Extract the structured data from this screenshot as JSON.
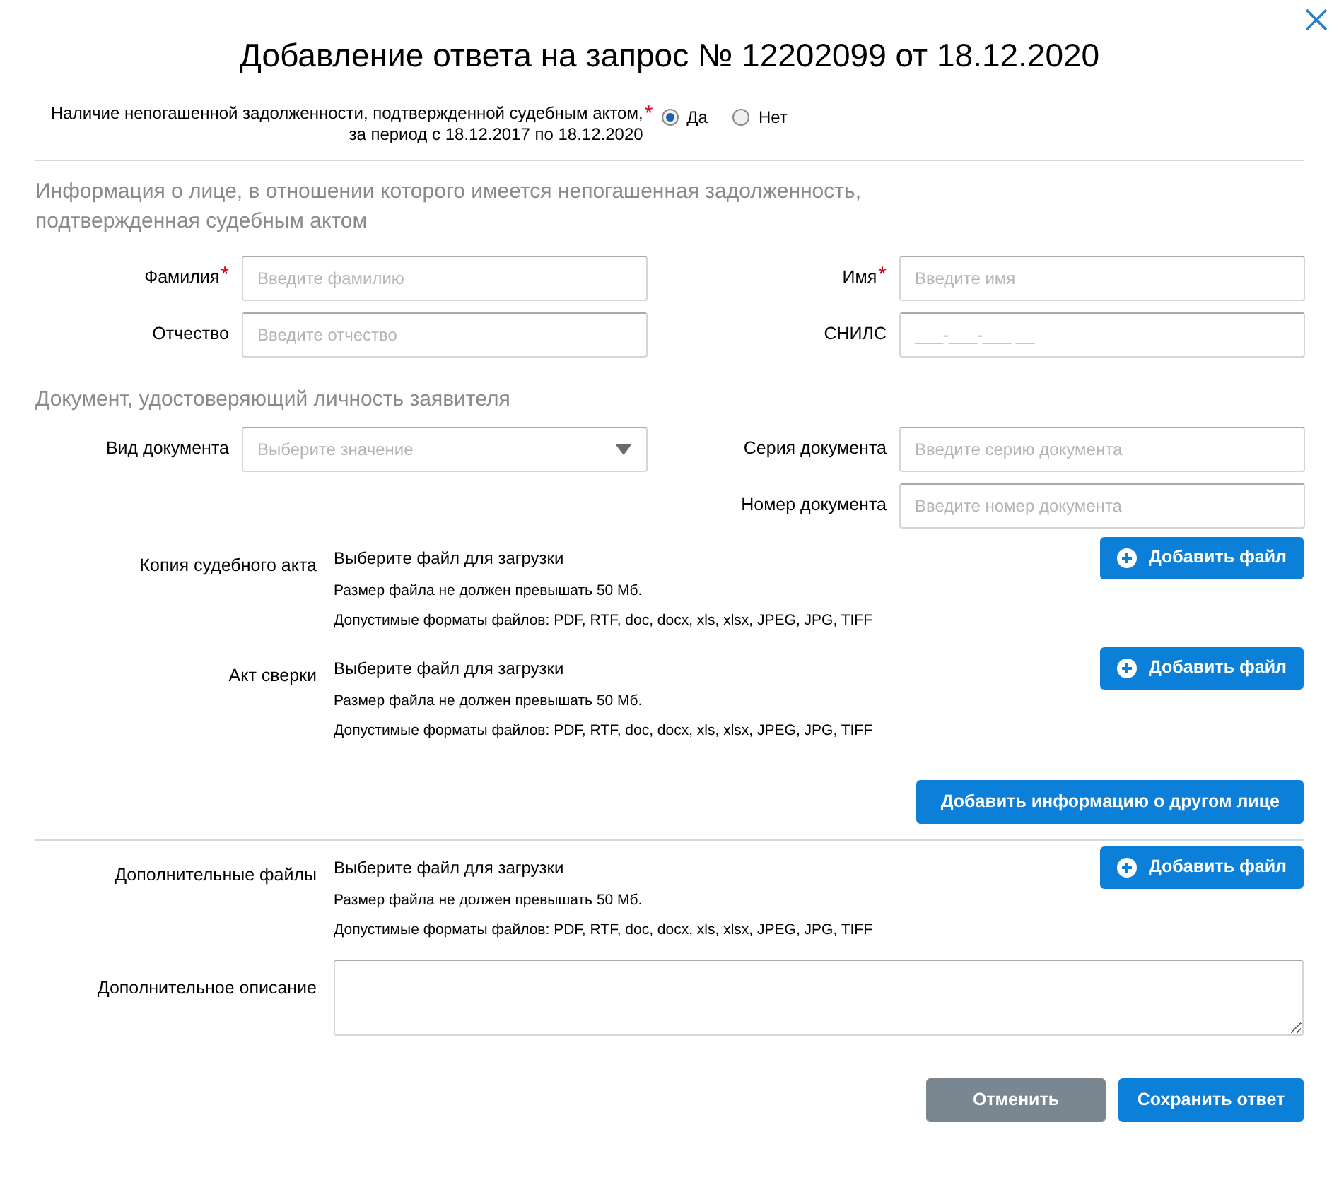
{
  "title": "Добавление ответа на запрос № 12202099 от 18.12.2020",
  "debt_question": {
    "line1": "Наличие непогашенной задолженности, подтвержденной судебным актом,",
    "line2": "за период с 18.12.2017 по 18.12.2020",
    "required_mark": "*",
    "options": [
      {
        "label": "Да",
        "selected": true
      },
      {
        "label": "Нет",
        "selected": false
      }
    ]
  },
  "person_section": {
    "heading": "Информация о лице, в отношении которого имеется непогашенная задолженность, подтвержденная судебным актом",
    "left": [
      {
        "label": "Фамилия",
        "required_mark": "*",
        "kind": "text",
        "placeholder": "Введите фамилию"
      },
      {
        "label": "Отчество",
        "kind": "text",
        "placeholder": "Введите отчество"
      }
    ],
    "right": [
      {
        "label": "Имя",
        "required_mark": "*",
        "kind": "text",
        "placeholder": "Введите имя"
      },
      {
        "label": "СНИЛС",
        "kind": "text",
        "placeholder": "___-___-___ __"
      }
    ]
  },
  "document_section": {
    "heading": "Документ, удостоверяющий личность заявителя",
    "left": [
      {
        "label": "Вид документа",
        "kind": "select",
        "placeholder": "Выберите значение"
      }
    ],
    "right": [
      {
        "label": "Серия документа",
        "kind": "text",
        "placeholder": "Введите серию документа"
      },
      {
        "label": "Номер документа",
        "kind": "text",
        "placeholder": "Введите номер документа"
      }
    ]
  },
  "files": [
    {
      "label": "Копия судебного акта",
      "prompt": "Выберите файл для загрузки",
      "size_note": "Размер файла не должен превышать 50 Мб.",
      "formats_note": "Допустимые форматы файлов: PDF, RTF, doc, docx, xls, xlsx, JPEG, JPG, TIFF",
      "button": "Добавить файл"
    },
    {
      "label": "Акт сверки",
      "prompt": "Выберите файл для загрузки",
      "size_note": "Размер файла не должен превышать 50 Мб.",
      "formats_note": "Допустимые форматы файлов: PDF, RTF, doc, docx, xls, xlsx, JPEG, JPG, TIFF",
      "button": "Добавить файл"
    }
  ],
  "add_person_button": "Добавить информацию о другом лице",
  "extra_files": {
    "label": "Дополнительные файлы",
    "prompt": "Выберите файл для загрузки",
    "size_note": "Размер файла не должен превышать 50 Мб.",
    "formats_note": "Допустимые форматы файлов: PDF, RTF, doc, docx, xls, xlsx, JPEG, JPG, TIFF",
    "button": "Добавить файл"
  },
  "description": {
    "label": "Дополнительное описание"
  },
  "buttons": [
    {
      "label": "Отменить",
      "kind": "secondary"
    },
    {
      "label": "Сохранить ответ",
      "kind": "primary"
    }
  ]
}
